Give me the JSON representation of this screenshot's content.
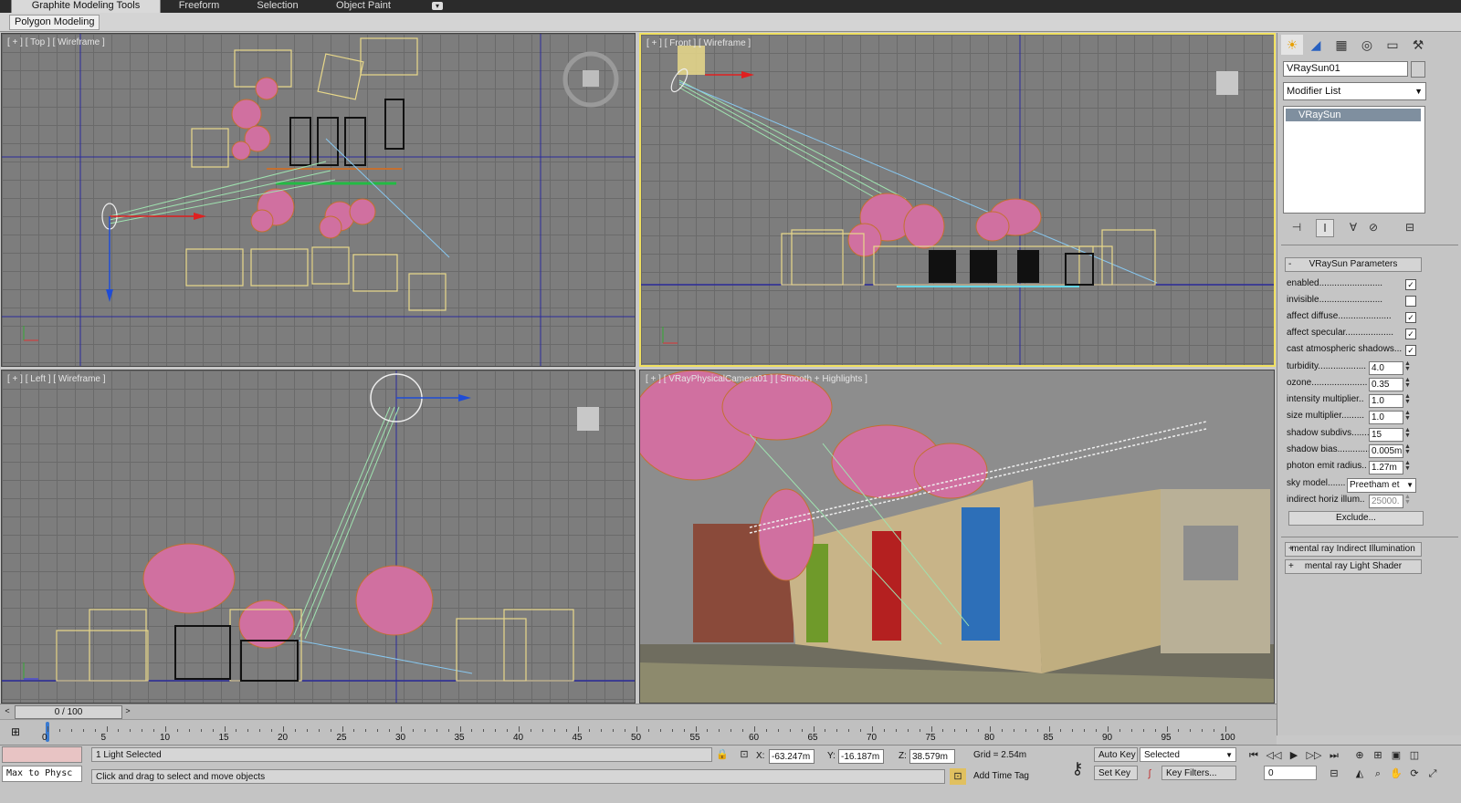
{
  "ribbon": {
    "tabs": [
      "Graphite Modeling Tools",
      "Freeform",
      "Selection",
      "Object Paint"
    ],
    "panel_button": "Polygon Modeling"
  },
  "viewports": {
    "top": {
      "label": "[ + ] [ Top ] [ Wireframe ]"
    },
    "front": {
      "label": "[ + ] [ Front ] [ Wireframe ]"
    },
    "left": {
      "label": "[ + ] [ Left ] [ Wireframe ]"
    },
    "camera": {
      "label": "[ + ] [ VRayPhysicalCamera01 ] [ Smooth + Highlights ]"
    }
  },
  "command_panel": {
    "tab_icons": [
      "sun-icon",
      "curve-icon",
      "hierarchy-icon",
      "motion-icon",
      "display-icon",
      "utilities-icon"
    ],
    "object_name": "VRaySun01",
    "modifier_list": "Modifier List",
    "stack_item": "VRaySun",
    "rollout_main": "VRaySun Parameters",
    "params": [
      {
        "label": "enabled.........................",
        "checked": true
      },
      {
        "label": "invisible.........................",
        "checked": false
      },
      {
        "label": "affect diffuse.....................",
        "checked": true
      },
      {
        "label": "affect specular...................",
        "checked": true
      },
      {
        "label": "cast atmospheric shadows...",
        "checked": true
      }
    ],
    "spinners": [
      {
        "label": "turbidity...................",
        "value": "4.0"
      },
      {
        "label": "ozone......................",
        "value": "0.35"
      },
      {
        "label": "intensity multiplier..",
        "value": "1.0"
      },
      {
        "label": "size multiplier.........",
        "value": "1.0"
      },
      {
        "label": "shadow subdivs.......",
        "value": "15"
      },
      {
        "label": "shadow bias.............",
        "value": "0.005m"
      },
      {
        "label": "photon emit radius..",
        "value": "1.27m"
      }
    ],
    "sky_model_label": "sky model.......",
    "sky_model_value": "Preetham et",
    "indirect_label": "indirect horiz illum..",
    "indirect_value": "25000.",
    "exclude_button": "Exclude...",
    "rollout_2": "mental ray Indirect Illumination",
    "rollout_3": "mental ray Light Shader"
  },
  "time_slider": {
    "value": "0 / 100",
    "prev": "<",
    "next": ">"
  },
  "trackbar": {
    "ticks": [
      "0",
      "5",
      "10",
      "15",
      "20",
      "25",
      "30",
      "35",
      "40",
      "45",
      "50",
      "55",
      "60",
      "65",
      "70",
      "75",
      "80",
      "85",
      "90",
      "95",
      "100"
    ]
  },
  "status": {
    "maxscript": "Max to Physc",
    "selection": "1 Light Selected",
    "prompt": "Click and drag to select and move objects",
    "x_label": "X:",
    "x_value": "-63.247m",
    "y_label": "Y:",
    "y_value": "-16.187m",
    "z_label": "Z:",
    "z_value": "38.579m",
    "grid": "Grid = 2.54m",
    "add_time_tag": "Add Time Tag",
    "auto_key": "Auto Key",
    "set_key": "Set Key",
    "selected_dropdown": "Selected",
    "key_filters": "Key Filters...",
    "frame_value": "0"
  }
}
